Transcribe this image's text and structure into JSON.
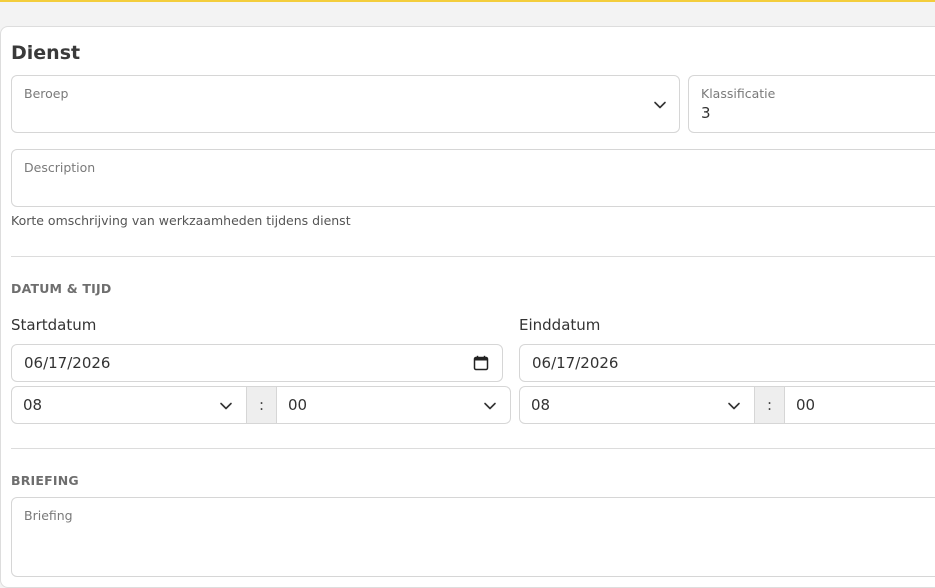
{
  "dienst": {
    "title": "Dienst",
    "beroep": {
      "label": "Beroep",
      "value": ""
    },
    "klassificatie": {
      "label": "Klassificatie",
      "value": "3"
    },
    "description": {
      "label": "Description",
      "value": "",
      "helper": "Korte omschrijving van werkzaamheden tijdens dienst"
    }
  },
  "datum_tijd": {
    "heading": "DATUM & TIJD",
    "start": {
      "label": "Startdatum",
      "date": "06/17/2026",
      "hour": "08",
      "minute": "00",
      "separator": ":"
    },
    "end": {
      "label": "Einddatum",
      "date": "06/17/2026",
      "hour": "08",
      "minute": "00",
      "separator": ":"
    }
  },
  "briefing": {
    "heading": "BRIEFING",
    "field": {
      "label": "Briefing",
      "value": ""
    }
  },
  "colors": {
    "accent_bar": "#f3cd3c"
  },
  "icons": {
    "dropdown": "chevron-down-icon",
    "calendar": "calendar-icon"
  }
}
